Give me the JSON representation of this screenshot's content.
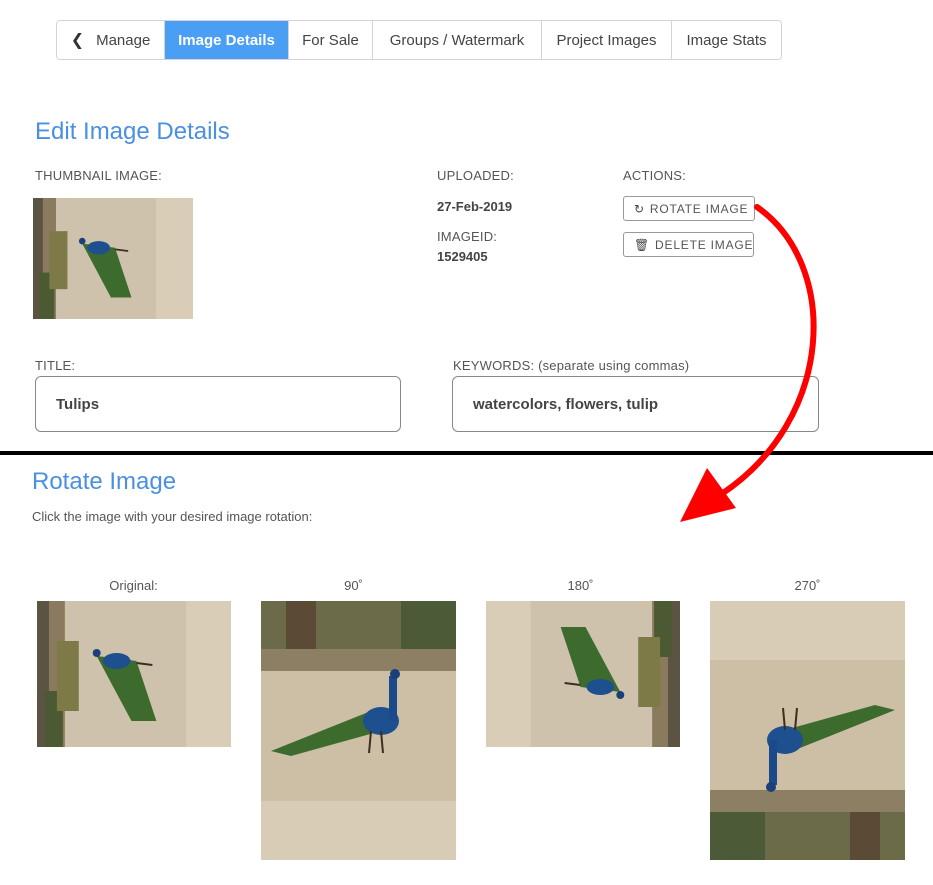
{
  "tabs": [
    {
      "label": "Manage",
      "icon": "chevron-left-icon",
      "active": false
    },
    {
      "label": "Image Details",
      "active": true
    },
    {
      "label": "For Sale",
      "active": false
    },
    {
      "label": "Groups / Watermark",
      "active": false
    },
    {
      "label": "Project Images",
      "active": false
    },
    {
      "label": "Image Stats",
      "active": false
    }
  ],
  "edit": {
    "heading": "Edit Image Details",
    "thumbnail_label": "THUMBNAIL IMAGE:",
    "uploaded_label": "UPLOADED:",
    "uploaded_value": "27-Feb-2019",
    "imageid_label": "IMAGEID:",
    "imageid_value": "1529405",
    "actions_label": "ACTIONS:",
    "rotate_button": "ROTATE IMAGE",
    "delete_button": "DELETE IMAGE",
    "title_label": "TITLE:",
    "title_value": "Tulips",
    "keywords_label": "KEYWORDS: (separate using commas)",
    "keywords_value": "watercolors, flowers, tulip"
  },
  "rotate": {
    "heading": "Rotate Image",
    "instruction": "Click the image with your desired image rotation:",
    "options": [
      "Original:",
      "90˚",
      "180˚",
      "270˚"
    ]
  },
  "colors": {
    "accent": "#4a9ff5",
    "heading": "#4a90e2",
    "annotation_arrow": "#ff0000"
  }
}
